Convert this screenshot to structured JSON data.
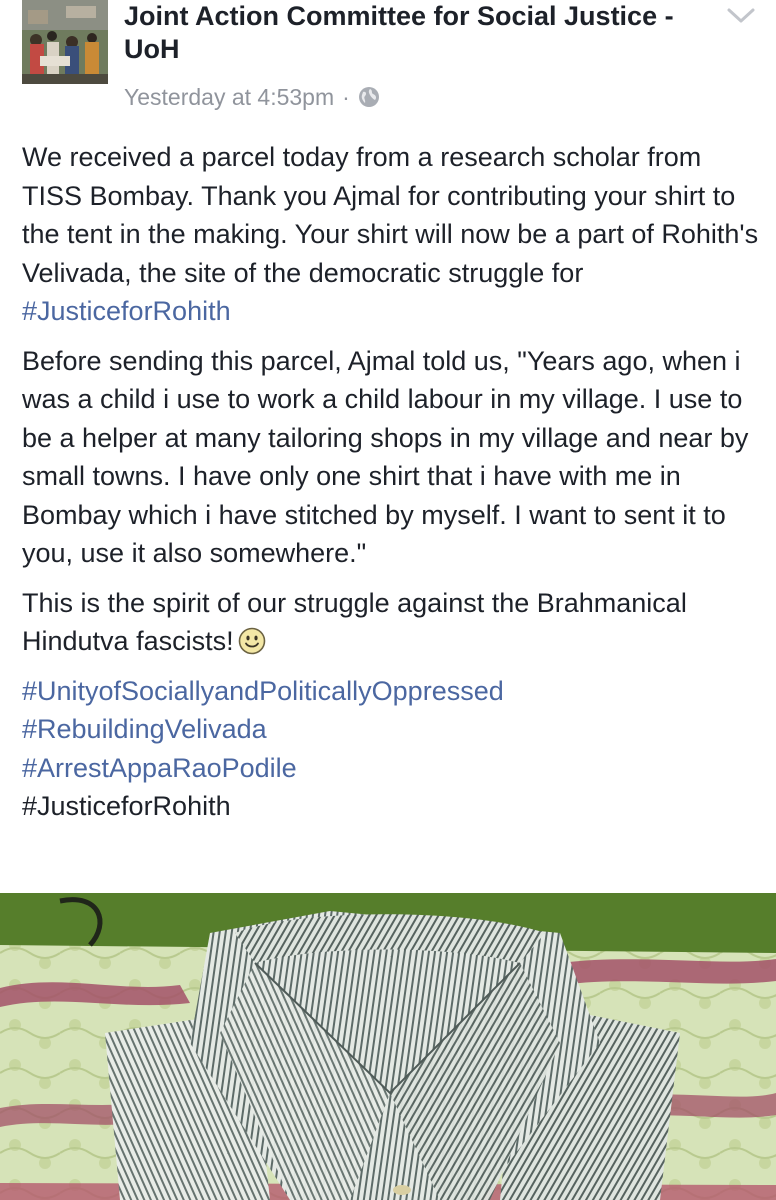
{
  "post": {
    "page_name": "Joint Action Committee for Social Justice -UoH",
    "timestamp": "Yesterday at 4:53pm",
    "separator": "·",
    "privacy_icon": "globe-icon",
    "menu_icon": "chevron-down-icon",
    "paragraph_1": {
      "text": "We received a parcel today from a research scholar from TISS Bombay. Thank you Ajmal for contributing your shirt to the tent in the making. Your shirt will now be a part of Rohith's Velivada, the site of the democratic struggle for ",
      "hashtag": "#JusticeforRohith"
    },
    "paragraph_2": "Before sending this parcel, Ajmal told us, \"Years ago, when i was a child i use to work a child labour in my village. I use to be a helper at many tailoring shops in my village and near by small towns. I have only one shirt that i have with me in Bombay which i have stitched by myself. I want to sent it to you, use it also somewhere.\"",
    "paragraph_3": {
      "text": "This is the spirit of our struggle against the Brahmanical Hindutva fascists!",
      "emoji_icon": "smiley-icon"
    },
    "hashtags": [
      "#UnityofSociallyandPoliticallyOppressed",
      "#RebuildingVelivada",
      "#ArrestAppaRaoPodile"
    ],
    "final_hashtag": "#JusticeforRohith",
    "photo": "striped-shirt-photo"
  },
  "colors": {
    "text": "#1d2129",
    "meta": "#90949c",
    "link": "#4b67a1",
    "photo_background": "#567e2b"
  }
}
